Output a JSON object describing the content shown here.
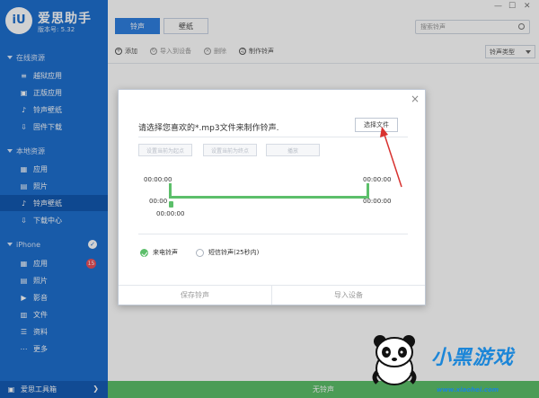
{
  "app": {
    "name": "爱思助手",
    "version": "版本号: 5.32",
    "logo_text": "iU"
  },
  "sidebar": {
    "online": {
      "title": "在线资源",
      "items": [
        {
          "label": "越狱应用",
          "icon": "layers-icon"
        },
        {
          "label": "正版应用",
          "icon": "bag-icon"
        },
        {
          "label": "铃声壁纸",
          "icon": "music-icon"
        },
        {
          "label": "固件下载",
          "icon": "download-icon"
        }
      ]
    },
    "local": {
      "title": "本地资源",
      "items": [
        {
          "label": "应用",
          "icon": "apps-icon"
        },
        {
          "label": "照片",
          "icon": "photo-icon"
        },
        {
          "label": "铃声壁纸",
          "icon": "music-icon"
        },
        {
          "label": "下载中心",
          "icon": "download-icon"
        }
      ]
    },
    "iphone": {
      "title": "iPhone",
      "items": [
        {
          "label": "应用",
          "icon": "apps-icon",
          "badge": "15"
        },
        {
          "label": "照片",
          "icon": "photo-icon"
        },
        {
          "label": "影音",
          "icon": "video-icon"
        },
        {
          "label": "文件",
          "icon": "file-icon"
        },
        {
          "label": "资料",
          "icon": "contacts-icon"
        },
        {
          "label": "更多",
          "icon": "more-icon"
        }
      ]
    },
    "footer_label": "爱思工具箱"
  },
  "main": {
    "tabs": [
      "铃声",
      "壁纸"
    ],
    "search_placeholder": "搜索铃声",
    "toolbar": [
      "添加",
      "导入到设备",
      "删除",
      "制作铃声"
    ],
    "type_select": "铃声类型",
    "status": "无铃声"
  },
  "dialog": {
    "title": "请选择您喜欢的*.mp3文件来制作铃声.",
    "choose_file": "选择文件",
    "set_start": "设置当前为起点",
    "set_end": "设置当前为终点",
    "play": "播放",
    "time_start_top": "00:00:00",
    "time_end_top": "00:00:00",
    "time_left_mid": "00:00",
    "time_end_bottom": "00:00:00",
    "time_handle": "00:00:00",
    "radio_call": "来电铃声",
    "radio_sms": "短信铃声(25秒内)",
    "save": "保存铃声",
    "import": "导入设备"
  },
  "watermark": {
    "text": "小黑游戏",
    "url": "www.xiaohei.com"
  }
}
